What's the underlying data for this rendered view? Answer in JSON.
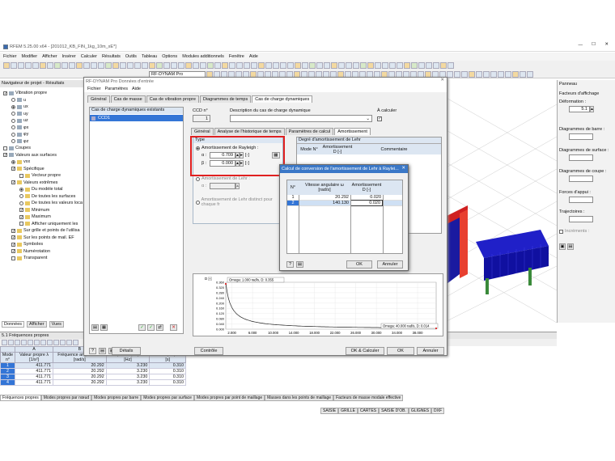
{
  "app": {
    "title": "RFEM 5.25.00 x64 - [201012_KB_FIN_1kg_10m_xE*]"
  },
  "menu": [
    "Fichier",
    "Modifier",
    "Afficher",
    "Insérer",
    "Calculer",
    "Résultats",
    "Outils",
    "Tableau",
    "Options",
    "Modules additionnels",
    "Fenêtre",
    "Aide"
  ],
  "toolbar": {
    "module": "RF-DYNAM Pro"
  },
  "nav": {
    "title": "Navigateur de projet - Résultats",
    "items": [
      "Vibration propre",
      "u",
      "ux",
      "uy",
      "uz",
      "φx",
      "φy",
      "φz",
      "Coupes",
      "Valeurs aux surfaces",
      "vxx",
      "Spécifique",
      "Vecteur propre",
      "Valeurs extrêmes",
      "Du modèle total",
      "De toutes les surfaces",
      "De toutes les valeurs loca",
      "Minimum",
      "Maximum",
      "Afficher uniquement les",
      "Sur grille et points de l'utilisa",
      "Sur les points de mail. EF",
      "Symboles",
      "Numérotation",
      "Transparent"
    ],
    "tabs": [
      "Données",
      "Afficher",
      "Vues"
    ]
  },
  "panel": {
    "title": "Panneau",
    "facteurs": "Facteurs d'affichage",
    "deformation": "Déformation :",
    "def_value": "5.1",
    "barre": "Diagrammes de barre :",
    "surface": "Diagrammes de surface :",
    "coupe": "Diagrammes de coupe :",
    "appui": "Forces d'appui :",
    "traj": "Trajectoires :",
    "incr": "Incréments :"
  },
  "table": {
    "title": "5.1 Fréquences propres",
    "headers": [
      "Mode n°",
      "Valeur propre λ [1/s²]",
      "Fréquence angulaire ω [rad/s]",
      "Fréquence propre f [Hz]",
      "Période propre T [s]"
    ],
    "col_letters": [
      "A",
      "B",
      "C",
      "D"
    ],
    "rows": [
      [
        "1",
        "411.771",
        "20.292",
        "3.230",
        "0.310"
      ],
      [
        "2",
        "411.771",
        "20.292",
        "3.230",
        "0.310"
      ],
      [
        "3",
        "411.771",
        "20.292",
        "3.230",
        "0.310"
      ],
      [
        "4",
        "411.771",
        "20.292",
        "3.230",
        "0.310"
      ]
    ],
    "bottom_tabs": [
      "Fréquences propres",
      "Modes propres par nœud",
      "Modes propres par barre",
      "Modes propres par surface",
      "Modes propres par point de maillage",
      "Masses dans les points de maillage",
      "Facteurs de masse modale effective"
    ]
  },
  "status": [
    "SAISIE",
    "GRILLE",
    "CARTES",
    "SAISIE D'OB.",
    "GLIGNES",
    "DXF"
  ],
  "dialog": {
    "title": "RF-DYNAM Pro Données d'entrée",
    "menu": [
      "Fichier",
      "Paramètres",
      "Aide"
    ],
    "tabs": [
      "Général",
      "Cas de masse",
      "Cas de vibration propre",
      "Diagrammes de temps",
      "Cas de charge dynamiques"
    ],
    "list_header": "Cas de charge dynamiques existants",
    "list_item": "CCD1",
    "ccd_label": "CCD n°",
    "ccd_value": "1",
    "desc_label": "Description du cas de charge dynamique",
    "calc_label": "À calculer",
    "subtabs": [
      "Général",
      "Analyse de l'historique de temps",
      "Paramètres de calcul",
      "Amortissement"
    ],
    "type": "Type",
    "rayleigh": "Amortissement de Rayleigh :",
    "alpha_label": "α :",
    "alpha": "0.709",
    "beta_label": "β :",
    "beta": "0.000",
    "unit": "[-]",
    "lehr": "Amortissement de Lehr :",
    "lehr_val": "",
    "lehr_distinct": "Amortissement de Lehr distinct pour chaque fr",
    "degre": "Degré d'amortissement de Lehr",
    "mode_h": "Mode N°",
    "amort_h": "Amortissement D [-]",
    "comment_h": "Commentaire",
    "graph": {
      "omega1": "Omega: 1.000 rad/s, D: 0.355",
      "omega2": "Omega: 40.000 rad/s, D: 0.014",
      "ylabel": "D [-]",
      "yticks": [
        "0.360",
        "0.320",
        "0.280",
        "0.240",
        "0.200",
        "0.160",
        "0.120",
        "0.080",
        "0.040",
        "0.000"
      ],
      "xticks": [
        "2.000",
        "6.000",
        "10.000",
        "14.000",
        "18.000",
        "22.000",
        "26.000",
        "30.000",
        "34.000",
        "38.000"
      ]
    },
    "buttons": {
      "details": "Détails",
      "controle": "Contrôle",
      "ok_calc": "OK & Calculer",
      "ok": "OK",
      "annuler": "Annuler"
    }
  },
  "conv": {
    "title": "Calcul de conversion de l'amortissement de Lehr à Raylei...",
    "col_n": "N°",
    "col_v": "Vitesse angulaire ω [rad/s]",
    "col_a": "Amortissement D [-]",
    "rows": [
      [
        "1",
        "20.292",
        "0.020"
      ],
      [
        "2",
        "140.130",
        "0.020"
      ]
    ],
    "ok": "OK",
    "annuler": "Annuler"
  }
}
